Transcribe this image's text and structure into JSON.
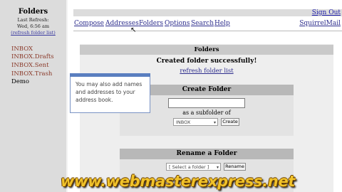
{
  "sidebar": {
    "title": "Folders",
    "last_refresh_label": "Last Refresh:",
    "last_refresh_time": "Wed, 6:56 am",
    "refresh_link": "(refresh folder list)",
    "folders": [
      "INBOX",
      "INBOX.Drafts",
      "INBOX.Sent",
      "INBOX.Trash",
      "Demo"
    ]
  },
  "header": {
    "sign_out": "Sign Out",
    "app_name": "SquirrelMail",
    "menu": [
      "Compose",
      "Addresses",
      "Folders",
      "Options",
      "Search",
      "Help"
    ]
  },
  "main": {
    "panel_title": "Folders",
    "success_message": "Created folder successfully!",
    "refresh_link": "refresh folder list",
    "create": {
      "title": "Create Folder",
      "subfolder_label": "as a subfolder of",
      "parent_select": "INBOX",
      "create_button": "Create"
    },
    "rename": {
      "title": "Rename a Folder",
      "select": "[ Select a folder ]",
      "rename_button": "Rename"
    }
  },
  "tooltip": {
    "text": "You may also add names and addresses to your address book."
  },
  "watermark": "www.webmasterexpress.net",
  "colors": {
    "sidebar_bg": "#dcdcdc",
    "link": "#2c2c8c",
    "folder_text": "#8a3a2a",
    "tooltip_border": "#5a7fc0",
    "watermark": "#f0c22a"
  }
}
